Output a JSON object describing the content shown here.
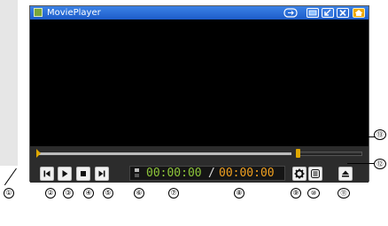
{
  "window": {
    "title": "MoviePlayer",
    "titlebar_color": "#2a6fdb",
    "titlebar_buttons": [
      {
        "name": "display-mode-icon",
        "glyph": "⇄"
      },
      {
        "name": "screen-icon",
        "glyph": "▭"
      },
      {
        "name": "minimize-icon",
        "glyph": "↙"
      },
      {
        "name": "close-icon",
        "glyph": "✕"
      },
      {
        "name": "home-icon",
        "glyph": "⌂"
      }
    ]
  },
  "playback": {
    "current_time": "00:00:00",
    "separator": "/",
    "total_time": "00:00:00",
    "progress_fraction": 0,
    "volume_fraction": 0,
    "current_color": "#8ec63a",
    "total_color": "#f0a020"
  },
  "controls": [
    {
      "name": "previous-button",
      "icon": "skip-previous-icon"
    },
    {
      "name": "play-button",
      "icon": "play-icon"
    },
    {
      "name": "stop-button",
      "icon": "stop-icon"
    },
    {
      "name": "next-button",
      "icon": "skip-next-icon"
    },
    {
      "name": "settings-button",
      "icon": "gear-icon"
    },
    {
      "name": "playlist-button",
      "icon": "list-icon"
    },
    {
      "name": "eject-button",
      "icon": "eject-icon"
    }
  ],
  "callouts": [
    "①",
    "②",
    "③",
    "④",
    "⑤",
    "⑥",
    "⑦",
    "⑧",
    "⑨",
    "⑩",
    "⑪",
    "⑫",
    "⑬"
  ]
}
